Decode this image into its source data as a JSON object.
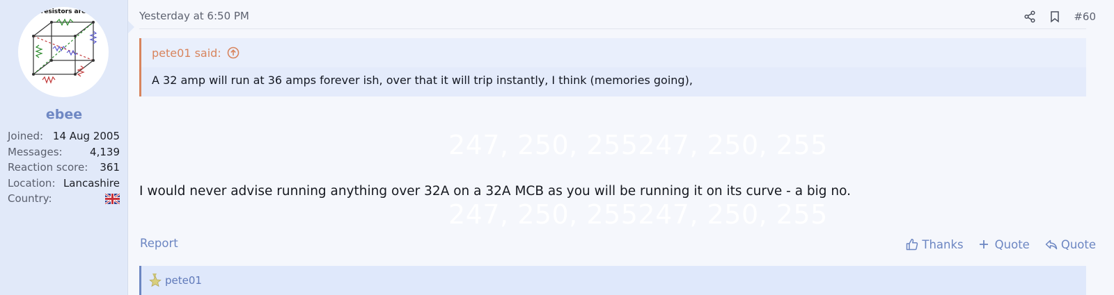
{
  "user": {
    "avatar_caption": ". resistors are .",
    "avatar_icon": "resistor-cube-diagram",
    "name": "ebee",
    "stats": [
      {
        "label": "Joined:",
        "value": "14 Aug 2005"
      },
      {
        "label": "Messages:",
        "value": "4,139"
      },
      {
        "label": "Reaction score:",
        "value": "361"
      },
      {
        "label": "Location:",
        "value": "Lancashire"
      },
      {
        "label": "Country:",
        "value": "",
        "icon": "uk-flag-icon"
      }
    ]
  },
  "post": {
    "date": "Yesterday at 6:50 PM",
    "number": "#60",
    "icons": [
      "share-icon",
      "bookmark-icon"
    ],
    "quote": {
      "author": "pete01 said:",
      "body": "A 32 amp will run at 36 amps forever ish, over that it will trip instantly, I think (memories going),"
    },
    "ghost_text_1": "247, 250, 255247, 250, 255",
    "ghost_text_2": "247, 250, 255247, 250, 255",
    "message": "I would never advise running anything over 32A on a 32A MCB as you will be running it on its curve - a big no.",
    "report_label": "Report",
    "actions": {
      "thanks_label": "Thanks",
      "quote_label": "Quote",
      "reply_label": "Quote"
    },
    "reaction_user": "pete01"
  },
  "colors": {
    "sidebar_bg": "#e1e9f9",
    "link": "#6c86c2",
    "quote_accent": "#d8845d",
    "page_bg": "#f5f7fc"
  }
}
